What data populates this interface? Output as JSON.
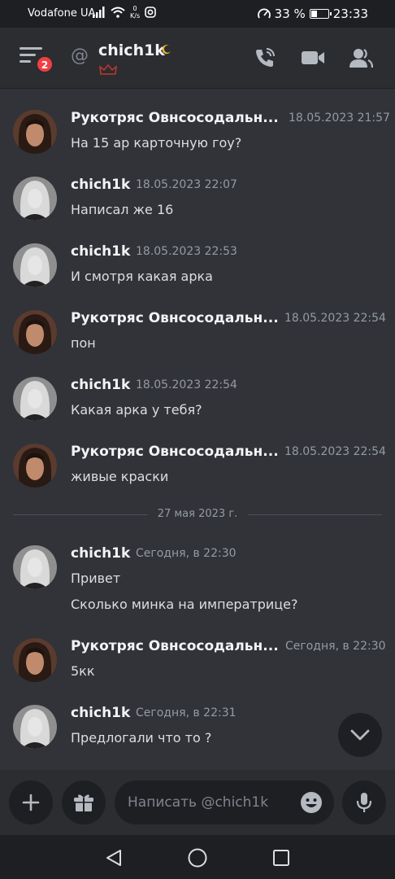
{
  "status_bar": {
    "carrier": "Vodafone UA",
    "net_speed_value": "0",
    "net_speed_unit": "K/s",
    "battery_percent": "33 %",
    "battery_level": 0.33,
    "time": "23:33"
  },
  "header": {
    "menu_badge": "2",
    "at_symbol": "@",
    "channel_name": "chich1k",
    "icons": [
      "hamburger-menu-icon",
      "moon-icon",
      "crown-icon",
      "phone-call-icon",
      "video-camera-icon",
      "members-icon"
    ]
  },
  "colors": {
    "background": "#313338",
    "header": "#2b2d31",
    "badge": "#f23f43",
    "muted_text": "#949ba4"
  },
  "messages": [
    {
      "author": "Рукотряс Овнсосодальн...",
      "timestamp": "18.05.2023 21:57",
      "lines": [
        "На 15 ар карточную гоу?"
      ]
    },
    {
      "author": "chich1k",
      "timestamp": "18.05.2023 22:07",
      "lines": [
        "Написал же 16"
      ]
    },
    {
      "author": "chich1k",
      "timestamp": "18.05.2023 22:53",
      "lines": [
        "И смотря какая арка"
      ]
    },
    {
      "author": "Рукотряс Овнсосодальн...",
      "timestamp": "18.05.2023 22:54",
      "lines": [
        "пон"
      ]
    },
    {
      "author": "chich1k",
      "timestamp": "18.05.2023 22:54",
      "lines": [
        "Какая арка у тебя?"
      ]
    },
    {
      "author": "Рукотряс Овнсосодальн...",
      "timestamp": "18.05.2023 22:54",
      "lines": [
        "живые краски"
      ]
    },
    {
      "author": "chich1k",
      "timestamp": "Сегодня, в 22:30",
      "lines": [
        "Привет",
        "Сколько минка на императрице?"
      ]
    },
    {
      "author": "Рукотряс Овнсосодальн...",
      "timestamp": "Сегодня, в 22:30",
      "lines": [
        "5кк"
      ]
    },
    {
      "author": "chich1k",
      "timestamp": "Сегодня, в 22:31",
      "lines": [
        "Предлогали что то ?"
      ]
    }
  ],
  "date_divider": "27 мая 2023 г.",
  "composer": {
    "placeholder": "Написать @chich1k",
    "icons": [
      "plus-icon",
      "gift-icon",
      "emoji-icon",
      "microphone-icon"
    ]
  },
  "nav_bar": {
    "icons": [
      "back-triangle-icon",
      "home-circle-icon",
      "recents-square-icon"
    ]
  }
}
